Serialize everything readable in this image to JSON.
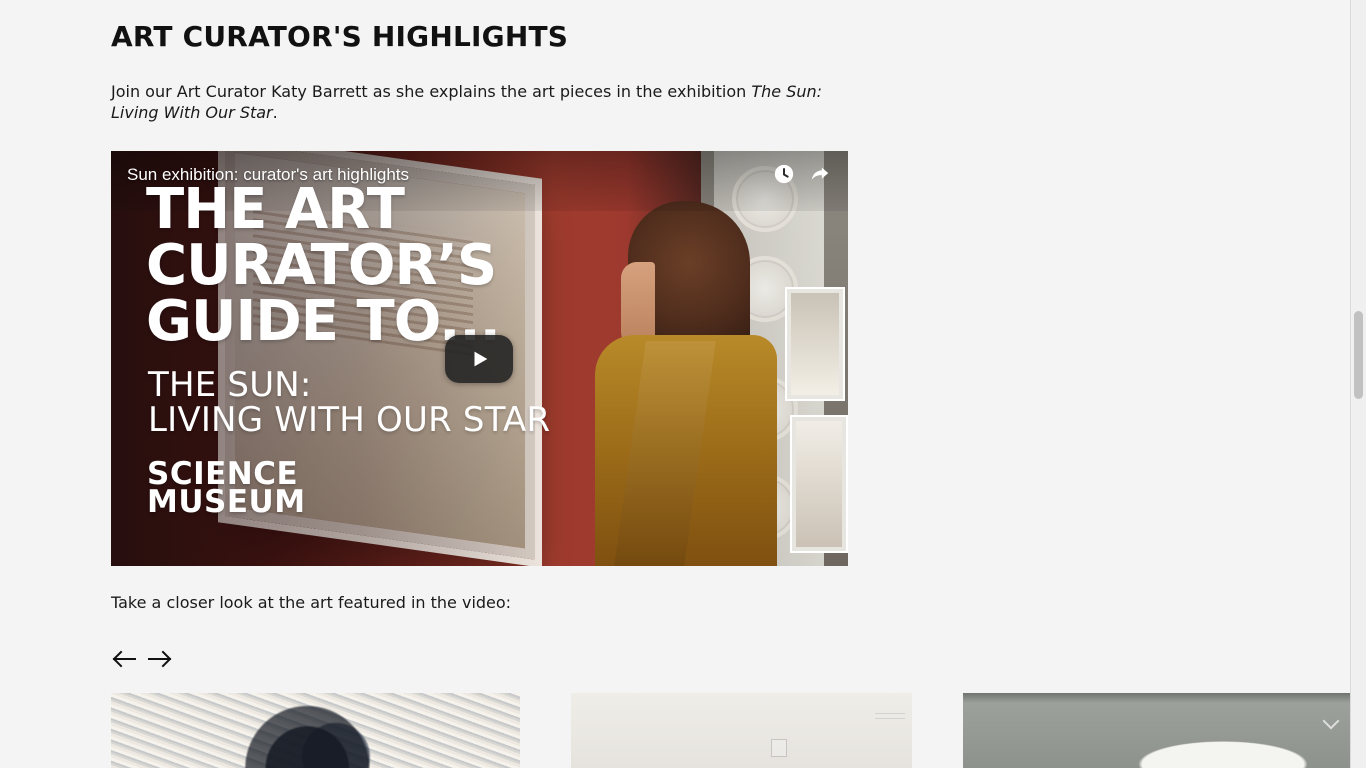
{
  "page": {
    "heading": "ART CURATOR'S HIGHLIGHTS",
    "intro_prefix": "Join our Art Curator Katy Barrett as she explains the art pieces in the exhibition ",
    "intro_italic": "The Sun: Living With Our Star",
    "intro_suffix": ".",
    "caption": "Take a closer look at the art featured in the video:"
  },
  "video": {
    "title": "Sun exhibition: curator's art highlights",
    "overlay_main": [
      "THE ART",
      "CURATOR’S",
      "GUIDE TO..."
    ],
    "overlay_sub": [
      "THE SUN:",
      "LIVING WITH OUR STAR"
    ],
    "overlay_brand": [
      "SCIENCE",
      "MUSEUM"
    ],
    "icons": {
      "watch_later": "clock-icon",
      "share": "share-icon",
      "play": "play-icon"
    }
  },
  "carousel": {
    "prev_icon": "arrow-left-icon",
    "next_icon": "arrow-right-icon"
  },
  "colors": {
    "page_background": "#f4f4f4",
    "text": "#111111",
    "video_title": "#ffffff",
    "play_button": "#212121"
  }
}
